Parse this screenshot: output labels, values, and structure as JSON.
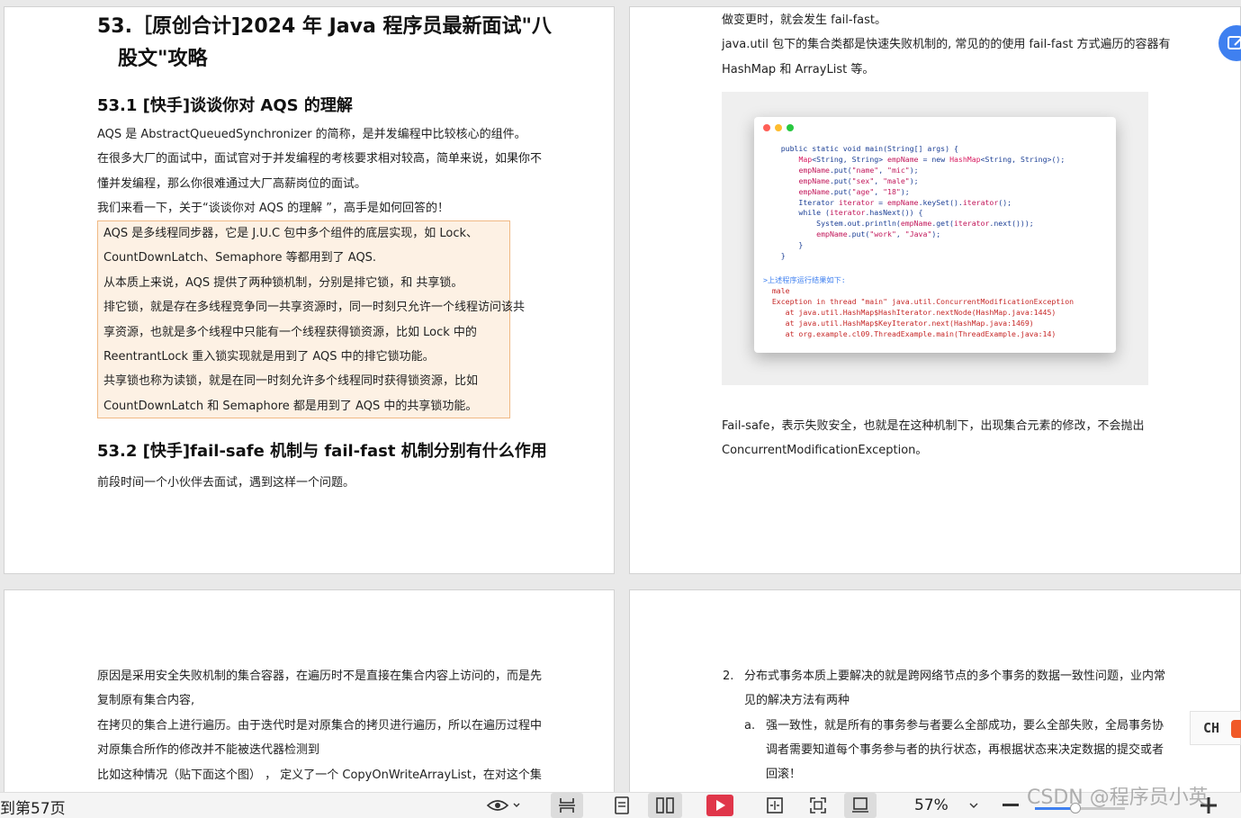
{
  "page1": {
    "title_l1": "53.［原创合计]2024 年 Java 程序员最新面试\"八",
    "title_l2": "股文\"攻略",
    "sec1_heading": "53.1 [快手]谈谈你对 AQS 的理解",
    "intro": [
      "AQS 是 AbstractQueuedSynchronizer 的简称，是并发编程中比较核心的组件。",
      "在很多大厂的面试中，面试官对于并发编程的考核要求相对较高，简单来说，如果你不",
      "懂并发编程，那么你很难通过大厂高薪岗位的面试。",
      "我们来看一下，关于“谈谈你对 AQS 的理解 ”，高手是如何回答的！"
    ],
    "answer": [
      "AQS 是多线程同步器，它是 J.U.C 包中多个组件的底层实现，如 Lock、",
      "CountDownLatch、Semaphore 等都用到了 AQS.",
      "从本质上来说，AQS 提供了两种锁机制，分别是排它锁，和 共享锁。",
      "排它锁，就是存在多线程竞争同一共享资源时，同一时刻只允许一个线程访问该共",
      "享资源，也就是多个线程中只能有一个线程获得锁资源，比如 Lock 中的",
      "ReentrantLock 重入锁实现就是用到了 AQS 中的排它锁功能。",
      "共享锁也称为读锁，就是在同一时刻允许多个线程同时获得锁资源，比如",
      "CountDownLatch 和 Semaphore 都是用到了 AQS 中的共享锁功能。"
    ],
    "sec2_heading": "53.2 [快手]fail-safe 机制与 fail-fast 机制分别有什么作用",
    "sec2_intro": "前段时间一个小伙伴去面试，遇到这样一个问题。"
  },
  "page2": {
    "top_lines": [
      "做变更时，就会发生 fail-fast。",
      "java.util 包下的集合类都是快速失败机制的, 常见的的使用 fail-fast 方式遍历的容器有",
      "HashMap 和 ArrayList 等。"
    ],
    "code_lines": [
      "    public static void main(String[] args) {",
      "        Map<String, String> empName = new HashMap<String, String>();",
      "        empName.put(\"name\", \"mic\");",
      "        empName.put(\"sex\", \"male\");",
      "        empName.put(\"age\", \"18\");",
      "        Iterator iterator = empName.keySet().iterator();",
      "        while (iterator.hasNext()) {",
      "            System.out.println(empName.get(iterator.next()));",
      "            empName.put(\"work\", \"Java\");",
      "        }",
      "    }"
    ],
    "output_lines": [
      ">上述程序运行结果如下:",
      "  male",
      "  Exception in thread \"main\" java.util.ConcurrentModificationException",
      "     at java.util.HashMap$HashIterator.nextNode(HashMap.java:1445)",
      "     at java.util.HashMap$KeyIterator.next(HashMap.java:1469)",
      "     at org.example.cl09.ThreadExample.main(ThreadExample.java:14)"
    ],
    "failsafe_lines": [
      "Fail-safe，表示失败安全，也就是在这种机制下，出现集合元素的修改，不会抛出",
      "ConcurrentModificationException。"
    ]
  },
  "page3": {
    "lines": [
      "原因是采用安全失败机制的集合容器，在遍历时不是直接在集合内容上访问的，而是先",
      "复制原有集合内容,",
      "在拷贝的集合上进行遍历。由于迭代时是对原集合的拷贝进行遍历，所以在遍历过程中",
      "对原集合所作的修改并不能被迭代器检测到",
      "比如这种情况（贴下面这个图） ，  定义了一个 CopyOnWriteArrayList，在对这个集"
    ]
  },
  "page4": {
    "item2_marker": "2.",
    "item2_l1": "分布式事务本质上要解决的就是跨网络节点的多个事务的数据一致性问题，业内常",
    "item2_l2": "见的解决方法有两种",
    "item_a_marker": "a.",
    "item_a_l1": "强一致性，就是所有的事务参与者要么全部成功，要么全部失败，全局事务协",
    "item_a_l2": "调者需要知道每个事务参与者的执行状态，再根据状态来决定数据的提交或者",
    "item_a_l3": "回滚！"
  },
  "side": {
    "ch_label": "CH"
  },
  "toolbar": {
    "page_indicator": "到第57页",
    "zoom": "57%",
    "zoom_fraction": 0.45
  },
  "watermark": "CSDN @程序员小英",
  "colors": {
    "quote_bg": "#fdf1e4",
    "quote_border": "#f0b984",
    "accent": "#3f80f0",
    "record": "#e0364a",
    "code_keyword": "#1c3f95",
    "code_string": "#c2185b",
    "code_error": "#c62828"
  }
}
